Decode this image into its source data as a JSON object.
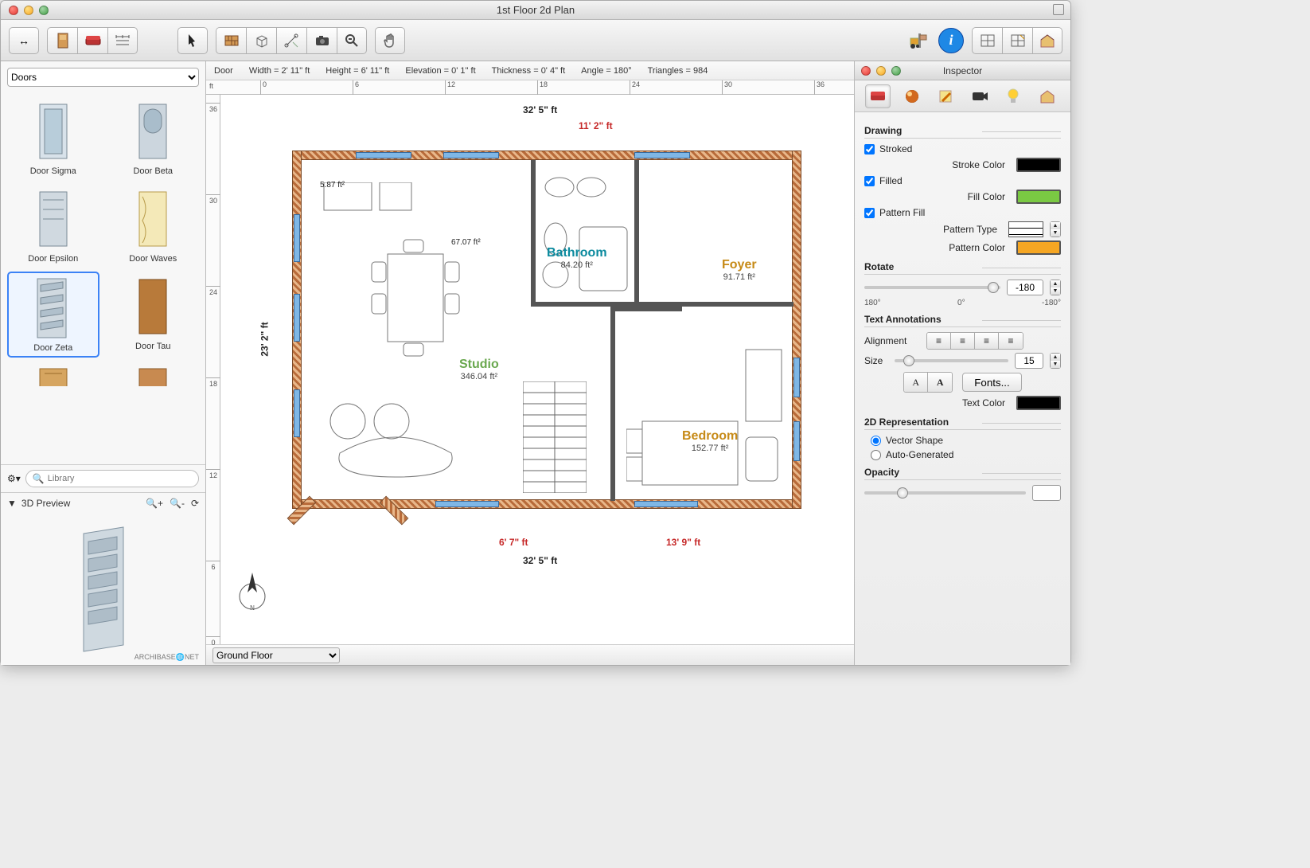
{
  "window": {
    "title": "1st Floor 2d Plan"
  },
  "toolbar": {
    "nav": "↔",
    "left_group_icons": [
      "door-icon",
      "sofa-icon",
      "dimensions-icon"
    ],
    "center_icons": [
      "pointer-icon",
      "wall-icon",
      "cube-icon",
      "measure-icon",
      "camera-icon",
      "zoom-icon",
      "hand-icon"
    ],
    "right_icons": [
      "forklift-icon",
      "info-icon",
      "view2d-icon",
      "view3d-icon",
      "home-icon"
    ]
  },
  "sidebar": {
    "category": "Doors",
    "items": [
      {
        "label": "Door Sigma"
      },
      {
        "label": "Door Beta"
      },
      {
        "label": "Door Epsilon"
      },
      {
        "label": "Door Waves"
      },
      {
        "label": "Door Zeta",
        "selected": true
      },
      {
        "label": "Door Tau"
      }
    ],
    "gear": "⚙",
    "search_placeholder": "Library",
    "preview_title": "3D Preview",
    "brand": "ARCHIBASE🌐NET"
  },
  "info_strip": {
    "object": "Door",
    "width": "Width = 2' 11\" ft",
    "height": "Height = 6' 11\" ft",
    "elevation": "Elevation = 0' 1\" ft",
    "thickness": "Thickness = 0' 4\" ft",
    "angle": "Angle = 180°",
    "triangles": "Triangles = 984"
  },
  "ruler": {
    "unit": "ft",
    "h_ticks": [
      "0",
      "6",
      "12",
      "18",
      "24",
      "30",
      "36"
    ],
    "v_ticks": [
      "36",
      "30",
      "24",
      "18",
      "12",
      "6",
      "0"
    ]
  },
  "plan": {
    "overall_w": "32' 5\" ft",
    "overall_h": "23' 2\" ft",
    "top_right": "11' 2\" ft",
    "bottom_left": "6' 7\" ft",
    "bottom_right": "13' 9\" ft",
    "rooms": [
      {
        "name": "Studio",
        "area": "346.04 ft²",
        "color": "#6aa84f"
      },
      {
        "name": "Bathroom",
        "area": "84.20 ft²",
        "color": "#0b8a9e"
      },
      {
        "name": "Foyer",
        "area": "91.71 ft²",
        "color": "#c68a17"
      },
      {
        "name": "Bedroom",
        "area": "152.77 ft²",
        "color": "#c68a17"
      }
    ],
    "small_areas": {
      "closet": "5.87 ft²",
      "kitchen": "67.07 ft²"
    }
  },
  "floor_selector": {
    "value": "Ground Floor"
  },
  "inspector": {
    "title": "Inspector",
    "tabs": [
      "object-tab",
      "material-tab",
      "edit-tab",
      "camera-tab",
      "light-tab",
      "house-tab"
    ],
    "drawing": {
      "header": "Drawing",
      "stroked_label": "Stroked",
      "stroked": true,
      "stroke_color_label": "Stroke Color",
      "stroke_color": "#000000",
      "filled_label": "Filled",
      "filled": true,
      "fill_color_label": "Fill Color",
      "fill_color": "#7ac943",
      "pattern_fill_label": "Pattern Fill",
      "pattern_fill": true,
      "pattern_type_label": "Pattern Type",
      "pattern_color_label": "Pattern Color",
      "pattern_color": "#f5a623"
    },
    "rotate": {
      "header": "Rotate",
      "value": "-180",
      "scale_left": "180°",
      "scale_mid": "0°",
      "scale_right": "-180°"
    },
    "text": {
      "header": "Text Annotations",
      "alignment_label": "Alignment",
      "size_label": "Size",
      "size_value": "15",
      "font_a_plain": "A",
      "font_a_bold": "A",
      "fonts_btn": "Fonts...",
      "text_color_label": "Text Color",
      "text_color": "#000000"
    },
    "rep": {
      "header": "2D Representation",
      "vector_label": "Vector Shape",
      "auto_label": "Auto-Generated",
      "selected": "vector"
    },
    "opacity": {
      "header": "Opacity"
    }
  }
}
